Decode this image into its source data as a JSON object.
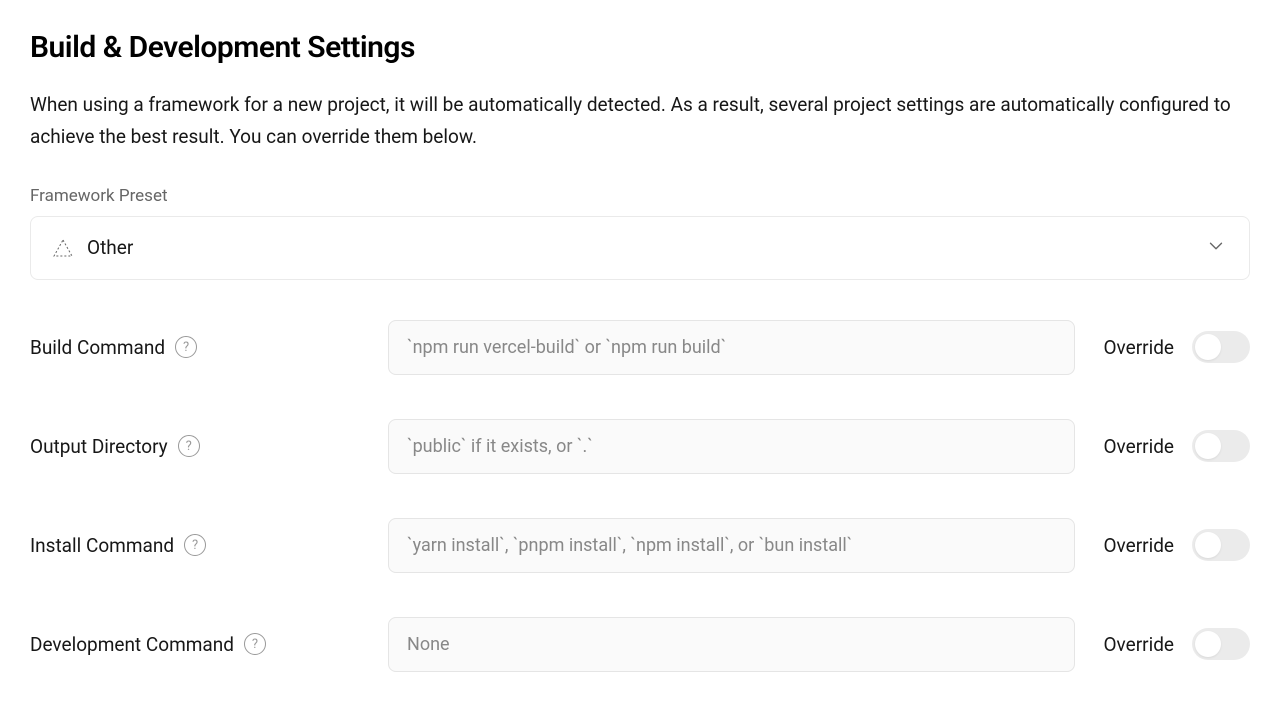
{
  "title": "Build & Development Settings",
  "description": "When using a framework for a new project, it will be automatically detected. As a result, several project settings are automatically configured to achieve the best result. You can override them below.",
  "framework_preset": {
    "label": "Framework Preset",
    "selected": "Other"
  },
  "rows": {
    "build_command": {
      "label": "Build Command",
      "placeholder": "`npm run vercel-build` or `npm run build`",
      "override_label": "Override"
    },
    "output_directory": {
      "label": "Output Directory",
      "placeholder": "`public` if it exists, or `.`",
      "override_label": "Override"
    },
    "install_command": {
      "label": "Install Command",
      "placeholder": "`yarn install`, `pnpm install`, `npm install`, or `bun install`",
      "override_label": "Override"
    },
    "development_command": {
      "label": "Development Command",
      "placeholder": "None",
      "override_label": "Override"
    }
  }
}
